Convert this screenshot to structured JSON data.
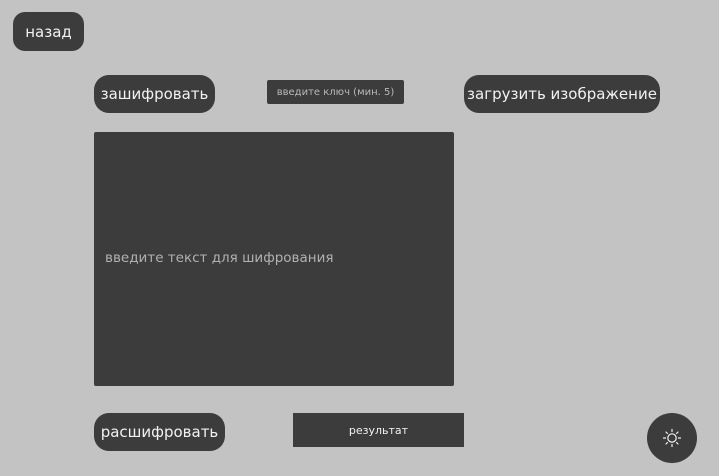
{
  "nav": {
    "back_label": "назад"
  },
  "actions": {
    "encrypt_label": "зашифровать",
    "upload_label": "загрузить изображение",
    "decrypt_label": "расшифровать"
  },
  "key_input": {
    "placeholder": "введите ключ (мин. 5)",
    "value": ""
  },
  "text_input": {
    "placeholder": "введите текст для шифрования",
    "value": ""
  },
  "result": {
    "label": "результат"
  },
  "theme_toggle": {
    "icon": "sun-icon"
  },
  "colors": {
    "background": "#c3c3c3",
    "surface": "#3c3c3c",
    "text": "#f2f2f2",
    "placeholder": "#b1b1b1"
  }
}
